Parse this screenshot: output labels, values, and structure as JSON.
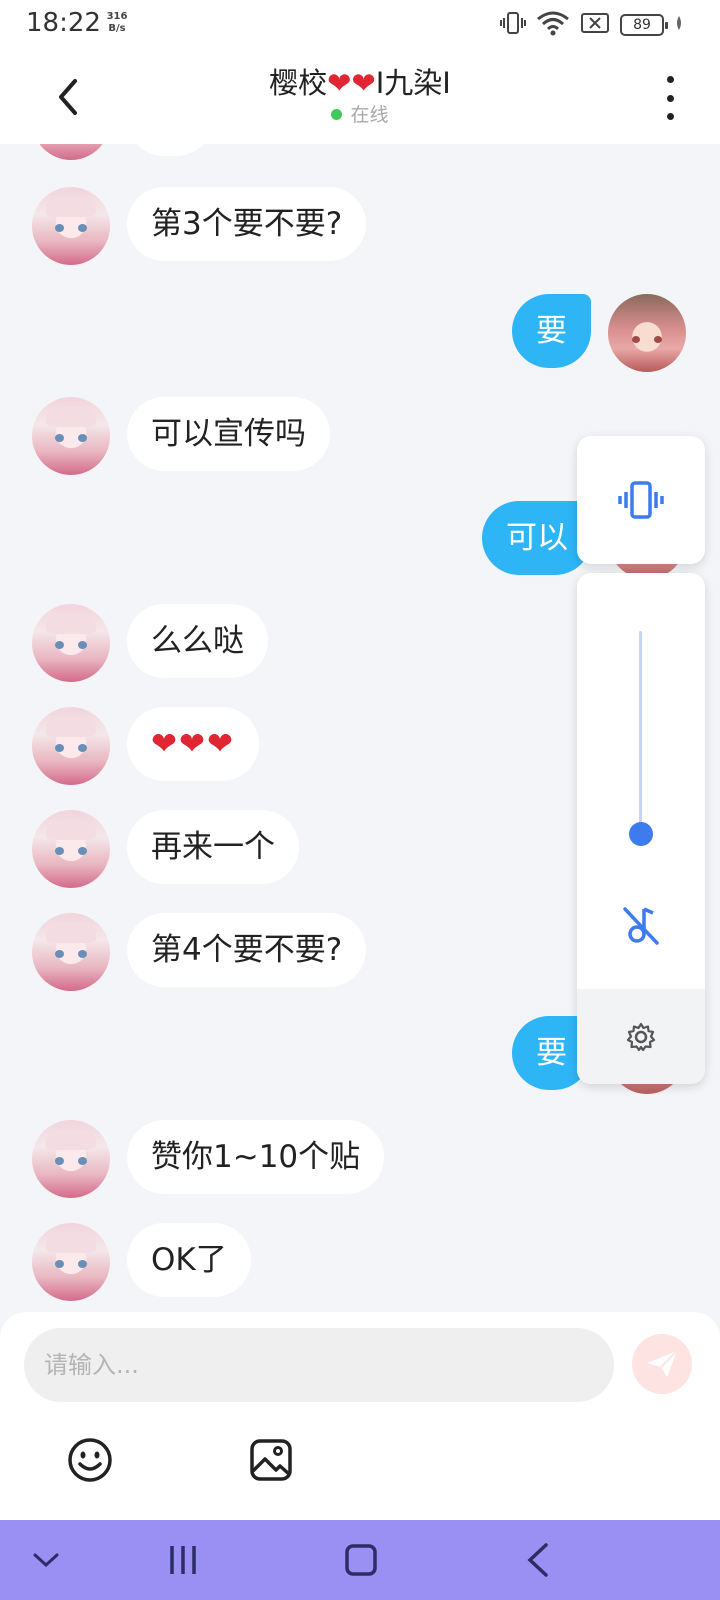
{
  "status_bar": {
    "time": "18:22",
    "net_speed_value": "316",
    "net_speed_unit": "B/s",
    "battery": "89",
    "icons": [
      "vibrate-icon",
      "wifi-icon",
      "no-sim-icon",
      "battery-icon",
      "charging-icon"
    ]
  },
  "header": {
    "back_icon": "chevron-left-icon",
    "title_prefix": "樱校",
    "title_hearts": "❤❤",
    "title_suffix": "I九染I",
    "status": "在线",
    "status_color": "#3fc95a",
    "more_icon": "more-vertical-icon"
  },
  "messages": [
    {
      "side": "left",
      "text": "第3个要不要?"
    },
    {
      "side": "right",
      "text": "要"
    },
    {
      "side": "left",
      "text": "可以宣传吗"
    },
    {
      "side": "right",
      "text": "可以"
    },
    {
      "side": "left",
      "text": "么么哒"
    },
    {
      "side": "left",
      "text": "❤❤❤"
    },
    {
      "side": "left",
      "text": "再来一个"
    },
    {
      "side": "left",
      "text": "第4个要不要?"
    },
    {
      "side": "right",
      "text": "要"
    },
    {
      "side": "left",
      "text": "赞你1~10个贴"
    },
    {
      "side": "left",
      "text": "OK了"
    }
  ],
  "volume_panel": {
    "mode_icon": "vibrate-icon",
    "level_fraction": 0.05,
    "mute_icon": "music-off-icon",
    "settings_icon": "gear-icon",
    "accent_color": "#3d7bef"
  },
  "composer": {
    "placeholder": "请输入...",
    "value": "",
    "send_icon": "send-icon",
    "tools": [
      "emoji-icon",
      "image-icon"
    ]
  },
  "nav_bar": {
    "buttons": [
      "chevron-down-icon",
      "recent-apps-icon",
      "home-icon",
      "back-icon"
    ],
    "color": "#9a8ff3"
  },
  "colors": {
    "sent_bubble": "#2eb5f6",
    "received_bubble": "#ffffff",
    "background": "#f4f5f8"
  }
}
